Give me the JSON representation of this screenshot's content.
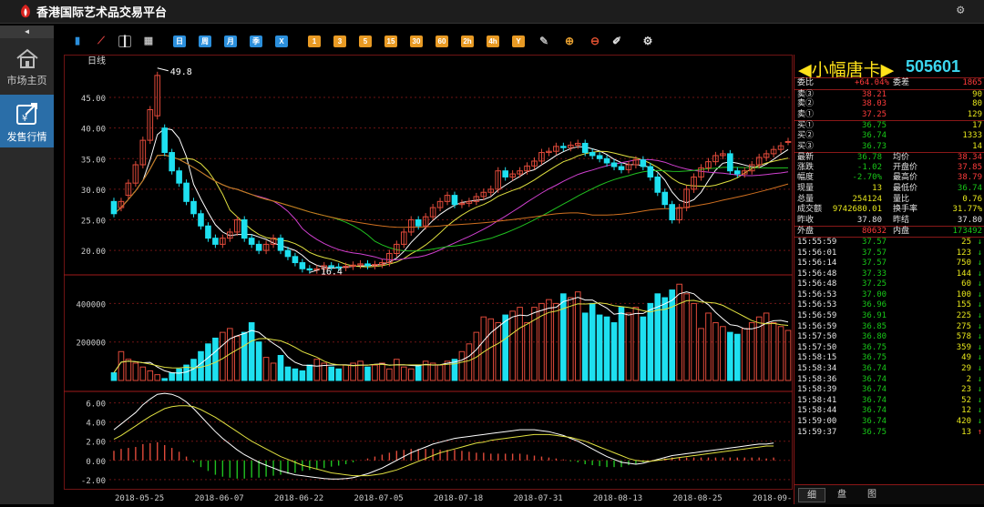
{
  "app": {
    "title": "香港国际艺术品交易平台"
  },
  "nav": {
    "items": [
      {
        "label": "市场主页"
      },
      {
        "label": "发售行情"
      }
    ]
  },
  "toolbar": {
    "tools_left": [
      "bar-chart-icon",
      "line-chart-icon",
      "candlestick-icon",
      "calendar-icon"
    ],
    "periods": [
      "日",
      "周",
      "月",
      "季",
      "X"
    ],
    "intraday": [
      "1",
      "3",
      "5",
      "15",
      "30",
      "60",
      "2h",
      "4h",
      "Y"
    ],
    "tools_right": [
      "edit-icon",
      "zoom-in-icon",
      "zoom-out-icon",
      "draw-icon",
      "settings-icon"
    ]
  },
  "chart": {
    "period_label": "日线",
    "price_high_label": "49.8",
    "price_low_label": "16.4",
    "dates": [
      "2018-05-25",
      "2018-06-07",
      "2018-06-22",
      "2018-07-05",
      "2018-07-18",
      "2018-07-31",
      "2018-08-13",
      "2018-08-25",
      "2018-09-12"
    ]
  },
  "chart_data": [
    {
      "type": "candlestick",
      "title": "日线",
      "ylim": [
        16,
        52
      ],
      "yticks": [
        "45.00",
        "40.00",
        "35.00",
        "30.00",
        "25.00",
        "20.00"
      ],
      "ytick_values": [
        45,
        40,
        35,
        30,
        25,
        20
      ],
      "annotations": [
        {
          "text": "49.8",
          "value": 49.8
        },
        {
          "text": "16.4",
          "value": 16.4
        }
      ],
      "x": [
        "2018-05-25",
        "2018-06-07",
        "2018-06-22",
        "2018-07-05",
        "2018-07-18",
        "2018-07-31",
        "2018-08-13",
        "2018-08-25",
        "2018-09-12"
      ],
      "closes": [
        26,
        28,
        31,
        34,
        38,
        43,
        48.6,
        36,
        33,
        31,
        28,
        26,
        24,
        22,
        21,
        22,
        23,
        25,
        22,
        21,
        20,
        21,
        22,
        20,
        19,
        18,
        17,
        16.8,
        17,
        17.5,
        17.3,
        17.2,
        17.4,
        17.6,
        17.8,
        17.5,
        17.7,
        18,
        19.5,
        21,
        23,
        25,
        24,
        25.5,
        27,
        28,
        29,
        27.5,
        27.7,
        28,
        28.8,
        29.5,
        30,
        33,
        32,
        32.5,
        33,
        33.8,
        34.6,
        36,
        36.2,
        37,
        36.8,
        37.2,
        37.5,
        36,
        35.5,
        35,
        34.3,
        33.7,
        33.2,
        34,
        34.8,
        33.7,
        32,
        29.5,
        27.5,
        25,
        27,
        30,
        32,
        33.5,
        34.5,
        35.5,
        35.8,
        33,
        32.5,
        33,
        34,
        35.2,
        35.8,
        36.5,
        37.1,
        37.8
      ],
      "opens": [
        28,
        27,
        29,
        31,
        34,
        38,
        42,
        40,
        36,
        33,
        31,
        28,
        26,
        24,
        22,
        21,
        22,
        23,
        25,
        22,
        21,
        20,
        21,
        22,
        20,
        19,
        18,
        17,
        16.8,
        17,
        17.5,
        17.3,
        17.2,
        17.4,
        17.6,
        17.8,
        17.5,
        17.7,
        18,
        19.5,
        21,
        23,
        25,
        24,
        25.5,
        27,
        28,
        29,
        27.5,
        27.7,
        28,
        28.8,
        29.5,
        30,
        33,
        32,
        32.5,
        33,
        33.8,
        34.6,
        36,
        36.2,
        37,
        36.8,
        37.2,
        37.5,
        36,
        35.5,
        35,
        34.3,
        33.7,
        33.2,
        34,
        34.8,
        33.7,
        32,
        29.5,
        27.5,
        25,
        27,
        30,
        32,
        33.5,
        34.5,
        35.5,
        35.8,
        33,
        32.5,
        33,
        34,
        35.2,
        35.8,
        36.5,
        37.8
      ]
    },
    {
      "type": "bar",
      "title": "volume",
      "yticks": [
        "400000",
        "200000"
      ],
      "ytick_values": [
        400000,
        200000
      ],
      "ylim": [
        0,
        520000
      ],
      "values": [
        40000,
        150000,
        110000,
        90000,
        70000,
        50000,
        30000,
        10000,
        40000,
        60000,
        80000,
        110000,
        150000,
        190000,
        220000,
        250000,
        270000,
        230000,
        250000,
        300000,
        200000,
        120000,
        90000,
        130000,
        70000,
        60000,
        50000,
        80000,
        110000,
        90000,
        70000,
        60000,
        80000,
        90000,
        100000,
        70000,
        80000,
        90000,
        60000,
        110000,
        70000,
        60000,
        80000,
        100000,
        90000,
        80000,
        100000,
        110000,
        150000,
        190000,
        250000,
        330000,
        320000,
        300000,
        340000,
        360000,
        380000,
        300000,
        380000,
        400000,
        420000,
        400000,
        450000,
        430000,
        460000,
        350000,
        400000,
        340000,
        330000,
        300000,
        380000,
        350000,
        380000,
        330000,
        400000,
        450000,
        430000,
        470000,
        500000,
        450000,
        400000,
        270000,
        350000,
        300000,
        280000,
        250000,
        240000,
        270000,
        300000,
        330000,
        350000,
        300000,
        280000,
        260000,
        270000,
        250000
      ]
    },
    {
      "type": "line",
      "title": "MACD",
      "yticks": [
        "6.00",
        "4.00",
        "2.00",
        "0.00",
        "-2.00"
      ],
      "ytick_values": [
        6,
        4,
        2,
        0,
        -2
      ],
      "ylim": [
        -2.3,
        7.2
      ],
      "series": [
        {
          "values": [
            3.2,
            3.8,
            4.4,
            5.0,
            5.8,
            6.4,
            6.9,
            7.0,
            6.9,
            6.6,
            6.1,
            5.4,
            4.6,
            3.8,
            3.0,
            2.3,
            1.7,
            1.1,
            0.6,
            0.2,
            -0.2,
            -0.5,
            -0.8,
            -1.1,
            -1.3,
            -1.5,
            -1.6,
            -1.7,
            -1.8,
            -1.9,
            -1.95,
            -1.95,
            -1.9,
            -1.8,
            -1.6,
            -1.4,
            -1.1,
            -0.8,
            -0.4,
            0.0,
            0.4,
            0.8,
            1.1,
            1.4,
            1.7,
            1.9,
            2.1,
            2.3,
            2.4,
            2.5,
            2.6,
            2.7,
            2.8,
            2.9,
            3.0,
            3.1,
            3.2,
            3.2,
            3.2,
            3.1,
            3.0,
            2.8,
            2.6,
            2.3,
            2.0,
            1.6,
            1.2,
            0.8,
            0.4,
            0.1,
            -0.2,
            -0.3,
            -0.4,
            -0.3,
            -0.1,
            0.1,
            0.3,
            0.5,
            0.6,
            0.7,
            0.8,
            0.9,
            1.0,
            1.1,
            1.2,
            1.3,
            1.4,
            1.5,
            1.6,
            1.7,
            1.7,
            1.8
          ]
        },
        {
          "values": [
            2.2,
            2.6,
            3.1,
            3.6,
            4.1,
            4.6,
            5.0,
            5.4,
            5.6,
            5.7,
            5.7,
            5.6,
            5.3,
            4.9,
            4.5,
            4.0,
            3.5,
            3.0,
            2.5,
            2.0,
            1.6,
            1.2,
            0.8,
            0.4,
            0.1,
            -0.2,
            -0.5,
            -0.7,
            -0.9,
            -1.1,
            -1.3,
            -1.4,
            -1.5,
            -1.6,
            -1.6,
            -1.6,
            -1.5,
            -1.4,
            -1.2,
            -1.0,
            -0.7,
            -0.4,
            -0.1,
            0.2,
            0.5,
            0.8,
            1.0,
            1.2,
            1.4,
            1.6,
            1.8,
            1.9,
            2.1,
            2.2,
            2.3,
            2.4,
            2.5,
            2.6,
            2.7,
            2.7,
            2.7,
            2.6,
            2.5,
            2.4,
            2.2,
            2.0,
            1.7,
            1.4,
            1.1,
            0.8,
            0.5,
            0.2,
            0.0,
            -0.1,
            -0.1,
            0.0,
            0.1,
            0.2,
            0.3,
            0.4,
            0.5,
            0.6,
            0.7,
            0.8,
            0.9,
            1.0,
            1.1,
            1.2,
            1.3,
            1.4,
            1.5,
            1.5
          ]
        }
      ],
      "histogram": [
        1.0,
        1.2,
        1.3,
        1.4,
        1.7,
        1.8,
        1.9,
        1.6,
        1.3,
        0.9,
        0.4,
        -0.2,
        -0.7,
        -1.1,
        -1.5,
        -1.7,
        -1.8,
        -1.9,
        -1.9,
        -1.8,
        -1.8,
        -1.7,
        -1.6,
        -1.5,
        -1.4,
        -1.3,
        -1.1,
        -1.0,
        -0.9,
        -0.8,
        -0.65,
        -0.55,
        -0.4,
        -0.2,
        0.0,
        0.2,
        0.4,
        0.6,
        0.8,
        1.0,
        1.1,
        1.2,
        1.2,
        1.2,
        1.2,
        1.1,
        1.1,
        1.1,
        1.0,
        0.9,
        0.8,
        0.8,
        0.7,
        0.7,
        0.7,
        0.7,
        0.7,
        0.6,
        0.5,
        0.4,
        0.3,
        0.2,
        0.1,
        -0.1,
        -0.2,
        -0.4,
        -0.5,
        -0.6,
        -0.7,
        -0.7,
        -0.7,
        -0.5,
        -0.4,
        -0.2,
        0.0,
        0.1,
        0.2,
        0.3,
        0.3,
        0.3,
        0.3,
        0.3,
        0.3,
        0.3,
        0.3,
        0.3,
        0.3,
        0.3,
        0.3,
        0.3,
        0.2,
        0.3
      ]
    }
  ],
  "quote": {
    "name": "小幅唐卡",
    "code": "505601",
    "weibi_label": "委比",
    "weibi_value": "+64.04%",
    "weicha_label": "委差",
    "weicha_value": "1865",
    "asks": [
      {
        "label": "卖③",
        "price": "38.21",
        "vol": "90"
      },
      {
        "label": "卖②",
        "price": "38.03",
        "vol": "80"
      },
      {
        "label": "卖①",
        "price": "37.25",
        "vol": "129"
      }
    ],
    "bids": [
      {
        "label": "买①",
        "price": "36.75",
        "vol": "17"
      },
      {
        "label": "买②",
        "price": "36.74",
        "vol": "1333"
      },
      {
        "label": "买③",
        "price": "36.73",
        "vol": "14"
      }
    ],
    "stats": [
      {
        "l1": "最新",
        "v1": "36.78",
        "l2": "均价",
        "v2": "38.34",
        "c1": "grn",
        "c2": "red"
      },
      {
        "l1": "涨跌",
        "v1": "-1.02",
        "l2": "开盘价",
        "v2": "37.85",
        "c1": "grn",
        "c2": "red"
      },
      {
        "l1": "幅度",
        "v1": "-2.70%",
        "l2": "最高价",
        "v2": "38.79",
        "c1": "grn",
        "c2": "red"
      },
      {
        "l1": "现量",
        "v1": "13",
        "l2": "最低价",
        "v2": "36.74",
        "c1": "yel",
        "c2": "grn"
      },
      {
        "l1": "总量",
        "v1": "254124",
        "l2": "量比",
        "v2": "0.76",
        "c1": "yel",
        "c2": "yel"
      },
      {
        "l1": "成交额",
        "v1": "9742680.01",
        "l2": "换手率",
        "v2": "31.77%",
        "c1": "yel",
        "c2": "yel"
      },
      {
        "l1": "昨收",
        "v1": "37.80",
        "l2": "昨结",
        "v2": "37.80",
        "c1": "lbl",
        "c2": "lbl"
      }
    ],
    "outer_label": "外盘",
    "outer_value": "80632",
    "inner_label": "内盘",
    "inner_value": "173492",
    "ticks": [
      {
        "t": "15:55:59",
        "p": "37.57",
        "v": "25",
        "d": "down"
      },
      {
        "t": "15:56:01",
        "p": "37.57",
        "v": "123",
        "d": "down"
      },
      {
        "t": "15:56:14",
        "p": "37.57",
        "v": "750",
        "d": "down"
      },
      {
        "t": "15:56:48",
        "p": "37.33",
        "v": "144",
        "d": "down"
      },
      {
        "t": "15:56:48",
        "p": "37.25",
        "v": "60",
        "d": "down"
      },
      {
        "t": "15:56:53",
        "p": "37.00",
        "v": "100",
        "d": "down"
      },
      {
        "t": "15:56:53",
        "p": "36.96",
        "v": "155",
        "d": "down"
      },
      {
        "t": "15:56:59",
        "p": "36.91",
        "v": "225",
        "d": "down"
      },
      {
        "t": "15:56:59",
        "p": "36.85",
        "v": "275",
        "d": "down"
      },
      {
        "t": "15:57:50",
        "p": "36.80",
        "v": "578",
        "d": "down"
      },
      {
        "t": "15:57:50",
        "p": "36.75",
        "v": "359",
        "d": "down"
      },
      {
        "t": "15:58:15",
        "p": "36.75",
        "v": "49",
        "d": "down"
      },
      {
        "t": "15:58:34",
        "p": "36.74",
        "v": "29",
        "d": "down"
      },
      {
        "t": "15:58:36",
        "p": "36.74",
        "v": "2",
        "d": "down"
      },
      {
        "t": "15:58:39",
        "p": "36.74",
        "v": "23",
        "d": "down"
      },
      {
        "t": "15:58:41",
        "p": "36.74",
        "v": "52",
        "d": "down"
      },
      {
        "t": "15:58:44",
        "p": "36.74",
        "v": "12",
        "d": "down"
      },
      {
        "t": "15:59:00",
        "p": "36.74",
        "v": "420",
        "d": "down"
      },
      {
        "t": "15:59:37",
        "p": "36.75",
        "v": "13",
        "d": "up"
      }
    ],
    "tabs": [
      "细",
      "盘",
      "图"
    ]
  },
  "colors": {
    "up": "#e04a3a",
    "down": "#1ee0f0",
    "grid": "#6e1414",
    "ma5": "#ffffff",
    "ma10": "#e0e040",
    "ma20": "#d040d0",
    "ma30": "#20c020",
    "ma60": "#d07020"
  }
}
